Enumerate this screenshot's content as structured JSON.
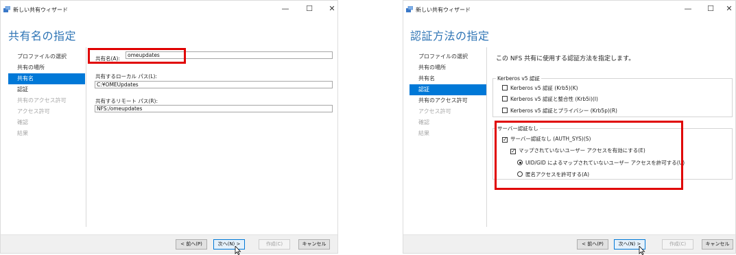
{
  "window_title": "新しい共有ウィザード",
  "controls": {
    "minimize": "—",
    "maximize": "☐",
    "close": "✕"
  },
  "nav_items": [
    "プロファイルの選択",
    "共有の場所",
    "共有名",
    "認証",
    "共有のアクセス許可",
    "アクセス許可",
    "確認",
    "結果"
  ],
  "buttons": {
    "prev": "< 前へ(P)",
    "next": "次へ(N) >",
    "create": "作成(C)",
    "cancel": "キャンセル"
  },
  "accent_colors": {
    "heading": "#2e74b5",
    "selected_nav": "#0078d7",
    "highlight_box": "#e00000"
  },
  "left": {
    "heading": "共有名の指定",
    "selected_nav_index": 2,
    "share_name_label": "共有名(A):",
    "share_name_value": "omeupdates",
    "local_path_label": "共有するローカル パス(L):",
    "local_path_value": "C:¥OMEUpdates",
    "remote_path_label": "共有するリモート パス(R):",
    "remote_path_value": "NFS:/omeupdates"
  },
  "right": {
    "heading": "認証方法の指定",
    "selected_nav_index": 3,
    "instruction": "この NFS 共有に使用する認証方法を指定します。",
    "kerberos_group_title": "Kerberos v5 認証",
    "kerberos_options": [
      {
        "label": "Kerberos v5 認証 (Krb5)(K)",
        "checked": false
      },
      {
        "label": "Kerberos v5 認証と整合性 (Krb5i)(I)",
        "checked": false
      },
      {
        "label": "Kerberos v5 認証とプライバシー (Krb5p)(R)",
        "checked": false
      }
    ],
    "server_auth_group_title": "サーバー認証なし",
    "no_server_auth": {
      "label": "サーバー認証なし (AUTH_SYS)(S)",
      "checked": true
    },
    "enable_unmapped": {
      "label": "マップされていないユーザー アクセスを有効にする(E)",
      "checked": true
    },
    "uid_gid_option": {
      "label": "UID/GID によるマップされていないユーザー アクセスを許可する(U)",
      "selected": true
    },
    "anonymous_option": {
      "label": "匿名アクセスを許可する(A)",
      "selected": false
    }
  }
}
